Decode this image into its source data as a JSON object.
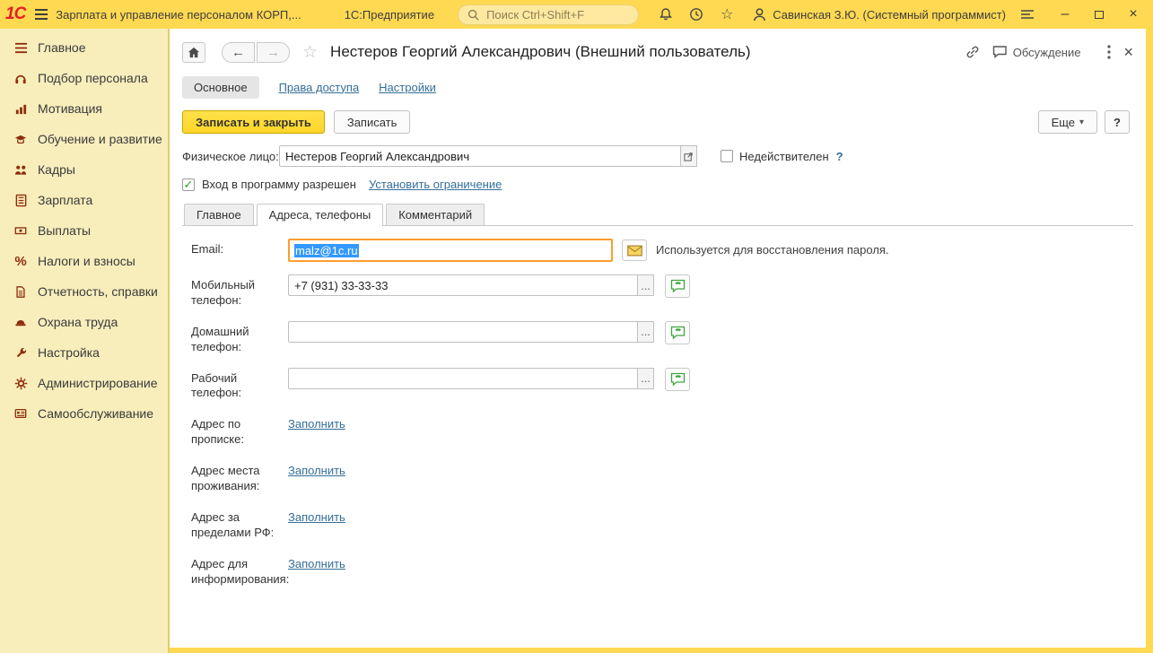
{
  "topbar": {
    "logo": "1С",
    "app_title": "Зарплата и управление персоналом КОРП,...",
    "platform_title": "1С:Предприятие",
    "search_placeholder": "Поиск Ctrl+Shift+F",
    "user": "Савинская З.Ю. (Системный программист)"
  },
  "icons": {
    "star": "☆",
    "back": "←",
    "forward": "→",
    "minimize": "–",
    "close": "×",
    "caret_down": "▾",
    "check": "✓",
    "ellipsis": "...",
    "percent": "%"
  },
  "sidebar": {
    "items": [
      {
        "label": "Главное"
      },
      {
        "label": "Подбор персонала"
      },
      {
        "label": "Мотивация"
      },
      {
        "label": "Обучение и развитие"
      },
      {
        "label": "Кадры"
      },
      {
        "label": "Зарплата"
      },
      {
        "label": "Выплаты"
      },
      {
        "label": "Налоги и взносы"
      },
      {
        "label": "Отчетность, справки"
      },
      {
        "label": "Охрана труда"
      },
      {
        "label": "Настройка"
      },
      {
        "label": "Администрирование"
      },
      {
        "label": "Самообслуживание"
      }
    ]
  },
  "doc": {
    "title": "Нестеров Георгий Александрович (Внешний пользователь)",
    "discussion_label": "Обсуждение"
  },
  "nav_tabs": {
    "main": "Основное",
    "access": "Права доступа",
    "settings": "Настройки"
  },
  "toolbar": {
    "save_close": "Записать и закрыть",
    "save": "Записать",
    "more": "Еще",
    "help": "?"
  },
  "form": {
    "person": {
      "label": "Физическое лицо:",
      "value": "Нестеров Георгий Александрович"
    },
    "invalid": {
      "label": "Недействителен",
      "help": "?"
    },
    "login": {
      "label": "Вход в программу разрешен",
      "link": "Установить ограничение"
    },
    "tabs": {
      "main": "Главное",
      "addresses": "Адреса, телефоны",
      "comment": "Комментарий"
    },
    "email": {
      "label": "Email:",
      "value": "malz@1c.ru",
      "hint": "Используется для восстановления пароля."
    },
    "phones": [
      {
        "label": "Мобильный телефон:",
        "value": "+7 (931) 33-33-33"
      },
      {
        "label": "Домашний телефон:",
        "value": ""
      },
      {
        "label": "Рабочий телефон:",
        "value": ""
      }
    ],
    "addresses": [
      {
        "label": "Адрес по прописке:",
        "link": "Заполнить"
      },
      {
        "label": "Адрес места проживания:",
        "link": "Заполнить"
      },
      {
        "label": "Адрес за пределами РФ:",
        "link": "Заполнить"
      },
      {
        "label": "Адрес для информирования:",
        "link": "Заполнить"
      }
    ]
  }
}
